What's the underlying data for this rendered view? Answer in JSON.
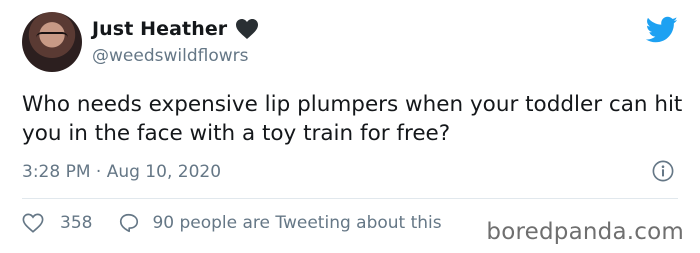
{
  "user": {
    "display_name": "Just Heather",
    "handle": "@weedswildflowrs",
    "name_emoji": "black-heart"
  },
  "tweet": {
    "text": "Who needs expensive lip plumpers when your toddler can hit you in the face with a toy train for free?",
    "timestamp": "3:28 PM · Aug 10, 2020"
  },
  "engagement": {
    "like_count": "358",
    "conversation_text": "90 people are Tweeting about this"
  },
  "watermark": "boredpanda.com",
  "icons": [
    "twitter-bird-icon",
    "heart-emoji-icon",
    "info-icon",
    "like-heart-icon",
    "reply-bubble-icon"
  ],
  "colors": {
    "brand_blue": "#1da1f2",
    "muted_text": "#657786",
    "text": "#14171a"
  }
}
